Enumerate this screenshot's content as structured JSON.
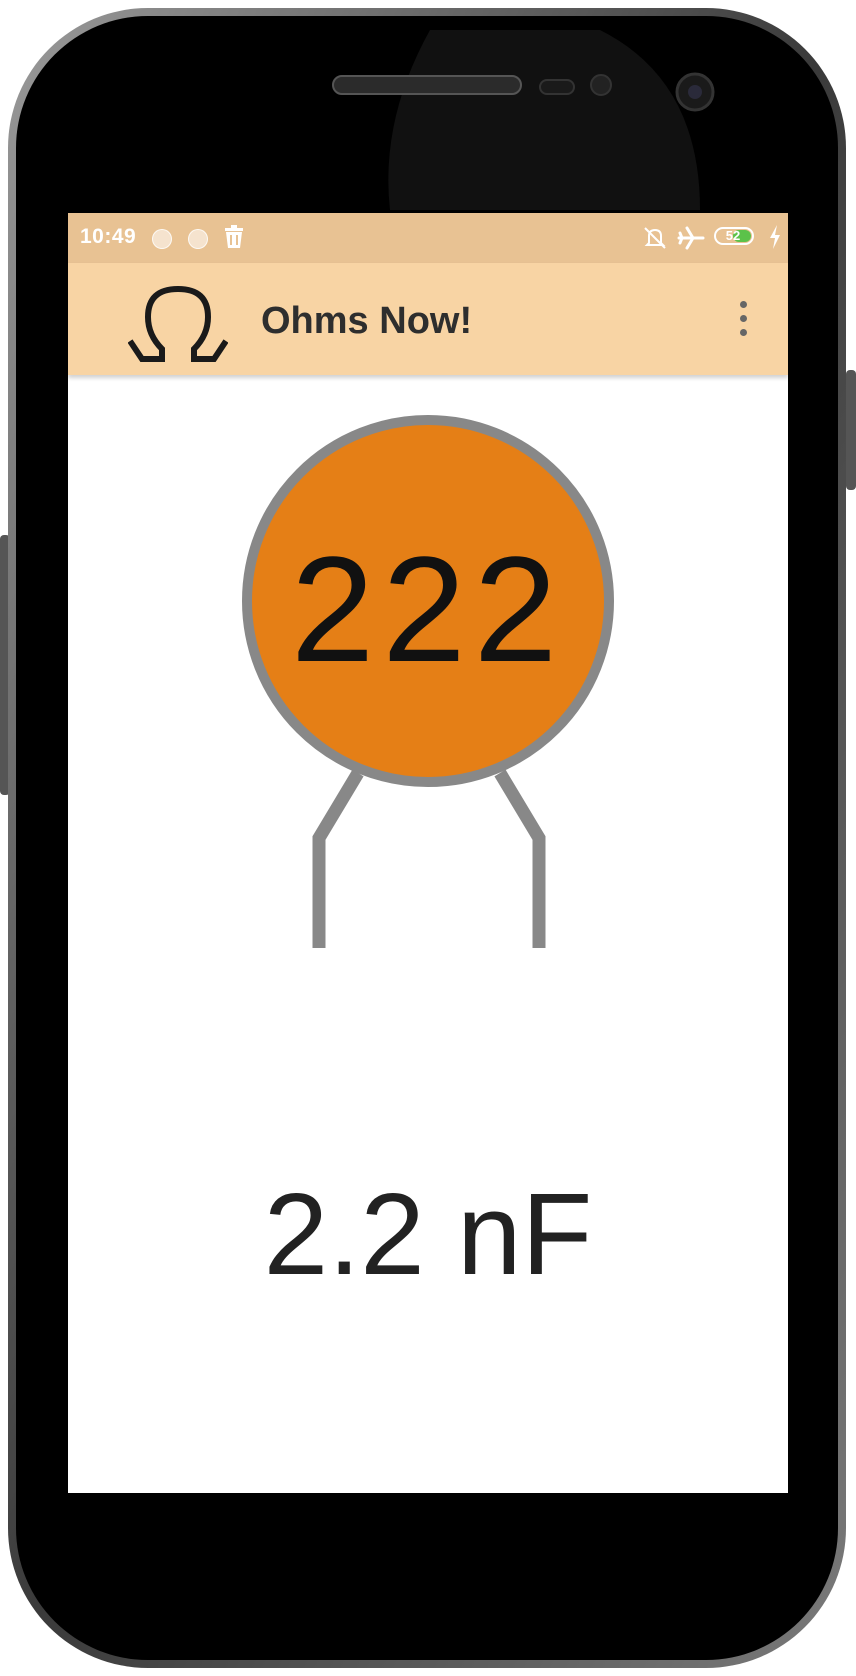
{
  "status_bar": {
    "time": "10:49",
    "battery_level": "52",
    "icons": [
      "notification-dot-icon",
      "notification-dot-icon",
      "trash-icon",
      "alarm-off-icon",
      "airplane-icon",
      "battery-icon",
      "charging-icon"
    ]
  },
  "app_bar": {
    "logo_icon": "omega-icon",
    "title": "Ohms Now!",
    "menu_icon": "overflow-menu-icon"
  },
  "capacitor": {
    "code": "222",
    "value": "2.2 nF"
  },
  "colors": {
    "status_bar": "#e8c293",
    "app_bar": "#f8d4a4",
    "capacitor_body": "#e57f16",
    "capacitor_outline": "#888888",
    "leads": "#888888"
  }
}
